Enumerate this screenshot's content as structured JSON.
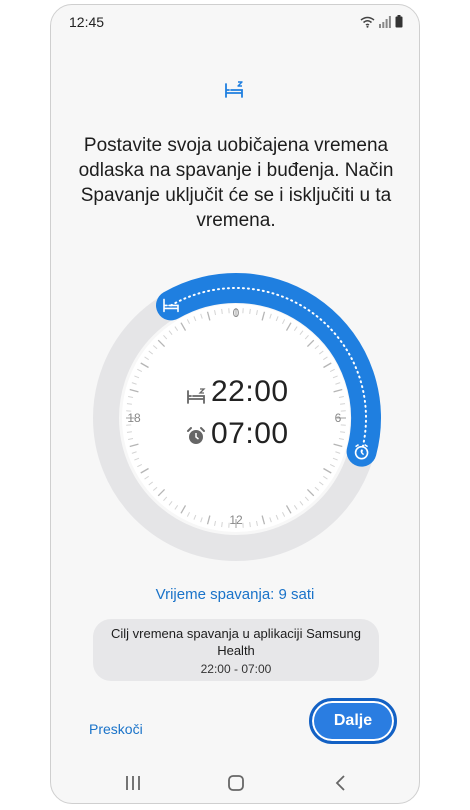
{
  "status_bar": {
    "time": "12:45",
    "icons": [
      "wifi-icon",
      "signal-icon",
      "battery-icon"
    ]
  },
  "header": {
    "icon": "bed-icon",
    "text": "Postavite svoja uobičajena vremena odlaska na spavanje i buđenja. Način Spavanje uključit će se i isključiti u ta vremena."
  },
  "dial": {
    "tick_labels": {
      "top": "0",
      "right": "6",
      "bottom": "12",
      "left": "18"
    },
    "bedtime": "22:00",
    "wake_time": "07:00",
    "bedtime_hour": 22,
    "wake_hour": 7,
    "accent_color": "#1f7fe0",
    "track_color": "#e5e5e7"
  },
  "sleep_duration": "Vrijeme spavanja: 9 sati",
  "goal_card": {
    "title": "Cilj vremena spavanja u aplikaciji Samsung Health",
    "range": "22:00 - 07:00"
  },
  "actions": {
    "skip_label": "Preskoči",
    "next_label": "Dalje"
  },
  "nav_bar": {
    "buttons": [
      "recent-apps-icon",
      "home-icon",
      "back-icon"
    ]
  }
}
